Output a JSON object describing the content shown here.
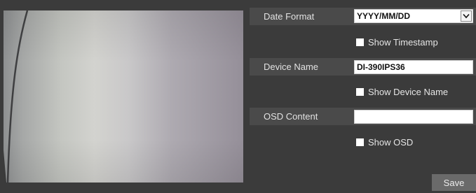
{
  "video": {
    "label": "camera-preview"
  },
  "date_format": {
    "label": "Date Format",
    "value": "YYYY/MM/DD",
    "show_label": "Show Timestamp",
    "show_checked": false
  },
  "device_name": {
    "label": "Device Name",
    "value": "DI-390IPS36",
    "show_label": "Show Device Name",
    "show_checked": false
  },
  "osd": {
    "label": "OSD Content",
    "value": "",
    "show_label": "Show OSD",
    "show_checked": false
  },
  "actions": {
    "save_label": "Save"
  },
  "colors": {
    "background": "#3b3b3b",
    "band": "#4a4a4a",
    "button": "#6a6a6a"
  },
  "icons": {
    "dropdown": "chevron-down-icon"
  }
}
